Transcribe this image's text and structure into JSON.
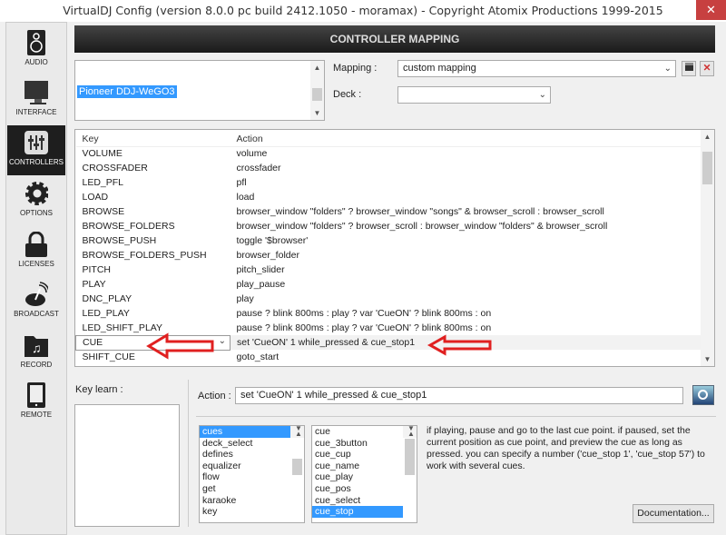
{
  "window": {
    "title": "VirtualDJ Config (version 8.0.0 pc build 2412.1050 - moramax) - Copyright Atomix Productions 1999-2015",
    "close": "✕"
  },
  "sidebar": {
    "items": [
      {
        "label": "AUDIO",
        "icon": "speaker-icon"
      },
      {
        "label": "INTERFACE",
        "icon": "monitor-icon"
      },
      {
        "label": "CONTROLLERS",
        "icon": "sliders-icon",
        "active": true
      },
      {
        "label": "OPTIONS",
        "icon": "gear-icon"
      },
      {
        "label": "LICENSES",
        "icon": "lock-icon"
      },
      {
        "label": "BROADCAST",
        "icon": "broadcast-icon"
      },
      {
        "label": "RECORD",
        "icon": "music-folder-icon"
      },
      {
        "label": "REMOTE",
        "icon": "tablet-icon"
      }
    ]
  },
  "header": {
    "title": "CONTROLLER MAPPING"
  },
  "devices": {
    "selected": "Pioneer DDJ-WeGO3"
  },
  "mapping": {
    "label": "Mapping :",
    "value": "custom mapping"
  },
  "deck": {
    "label": "Deck :",
    "value": ""
  },
  "table": {
    "headers": [
      "Key",
      "Action"
    ],
    "rows": [
      [
        "VOLUME",
        "volume"
      ],
      [
        "CROSSFADER",
        "crossfader"
      ],
      [
        "LED_PFL",
        "pfl"
      ],
      [
        "LOAD",
        "load"
      ],
      [
        "BROWSE",
        "browser_window \"folders\" ? browser_window \"songs\" & browser_scroll : browser_scroll"
      ],
      [
        "BROWSE_FOLDERS",
        "browser_window \"folders\" ? browser_scroll : browser_window \"folders\" & browser_scroll"
      ],
      [
        "BROWSE_PUSH",
        "toggle '$browser'"
      ],
      [
        "BROWSE_FOLDERS_PUSH",
        "browser_folder"
      ],
      [
        "PITCH",
        "pitch_slider"
      ],
      [
        "PLAY",
        "play_pause"
      ],
      [
        "DNC_PLAY",
        "play"
      ],
      [
        "LED_PLAY",
        "pause ? blink 800ms : play ? var 'CueON' ? blink 800ms : on"
      ],
      [
        "LED_SHIFT_PLAY",
        "pause ? blink 800ms : play ? var 'CueON' ? blink 800ms : on"
      ],
      [
        "CUE",
        "set 'CueON' 1 while_pressed & cue_stop1"
      ],
      [
        "SHIFT_CUE",
        "goto_start"
      ]
    ],
    "selected_index": 13
  },
  "keylearn": {
    "label": "Key learn :"
  },
  "action": {
    "label": "Action :",
    "value": "set 'CueON' 1 while_pressed & cue_stop1"
  },
  "categories": {
    "items": [
      "cues",
      "deck_select",
      "defines",
      "equalizer",
      "flow",
      "get",
      "karaoke",
      "key"
    ],
    "selected": "cues"
  },
  "verbs": {
    "items": [
      "cue",
      "cue_3button",
      "cue_cup",
      "cue_name",
      "cue_play",
      "cue_pos",
      "cue_select",
      "cue_stop"
    ],
    "selected": "cue_stop"
  },
  "description": "if playing, pause and go to the last cue point. if paused, set the current position as cue point, and preview the cue as long as pressed. you can specify a number ('cue_stop 1', 'cue_stop 57') to work with several cues.",
  "documentation_button": "Documentation...",
  "colors": {
    "accent": "#3399ff",
    "arrow": "#e02020",
    "header": "#1a1a1a"
  }
}
